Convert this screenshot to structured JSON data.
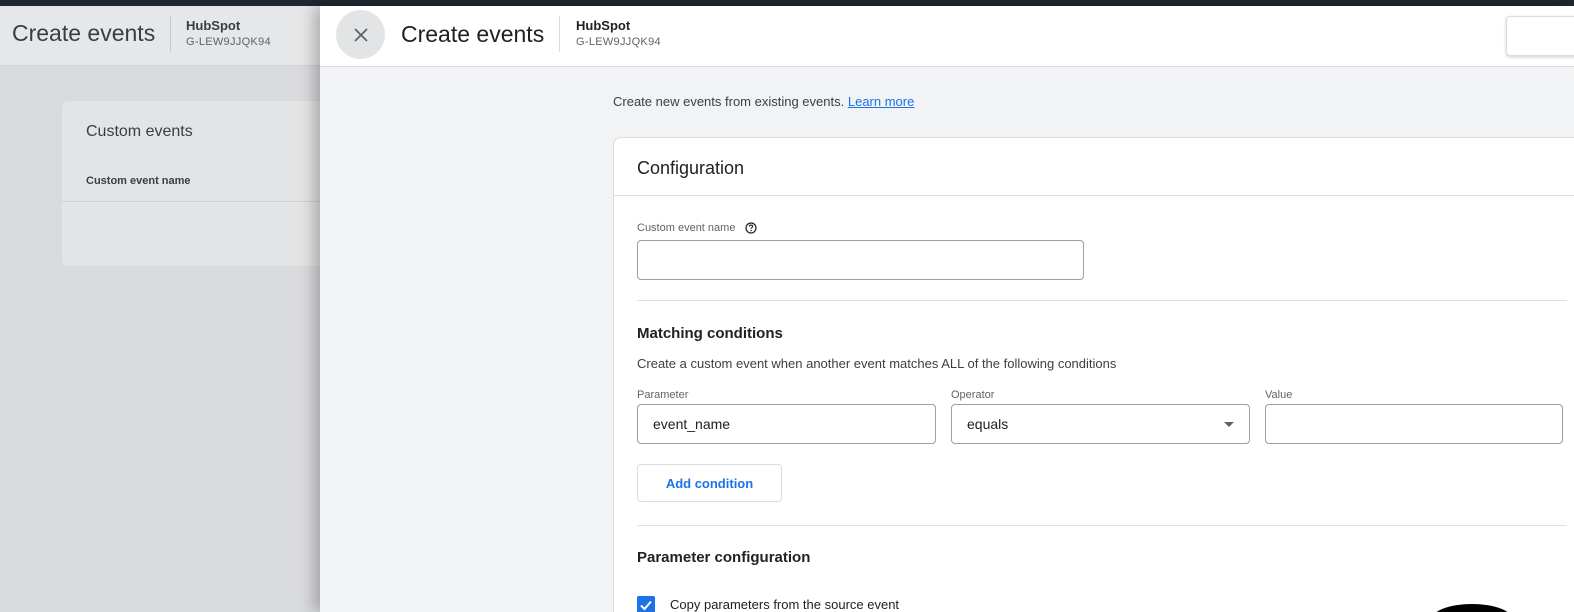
{
  "background": {
    "title": "Create events",
    "account_name": "HubSpot",
    "account_id": "G-LEW9JJQK94",
    "card_title": "Custom events",
    "card_column": "Custom event name"
  },
  "panel": {
    "title": "Create events",
    "account_name": "HubSpot",
    "account_id": "G-LEW9JJQK94",
    "close_icon": "close-icon",
    "intro_text": "Create new events from existing events.",
    "learn_more": "Learn more",
    "configuration": {
      "title": "Configuration",
      "custom_event_name_label": "Custom event name",
      "custom_event_name_value": "",
      "matching": {
        "title": "Matching conditions",
        "description": "Create a custom event when another event matches ALL of the following conditions",
        "parameter_label": "Parameter",
        "parameter_value": "event_name",
        "operator_label": "Operator",
        "operator_value": "equals",
        "value_label": "Value",
        "value_value": "",
        "add_condition": "Add condition"
      },
      "parameter_config": {
        "title": "Parameter configuration",
        "copy_params_label": "Copy parameters from the source event",
        "copy_params_checked": true
      }
    }
  },
  "colors": {
    "accent": "#1a73e8",
    "overlay_bg": "#d9dadc",
    "panel_bg": "#f1f3f4"
  }
}
